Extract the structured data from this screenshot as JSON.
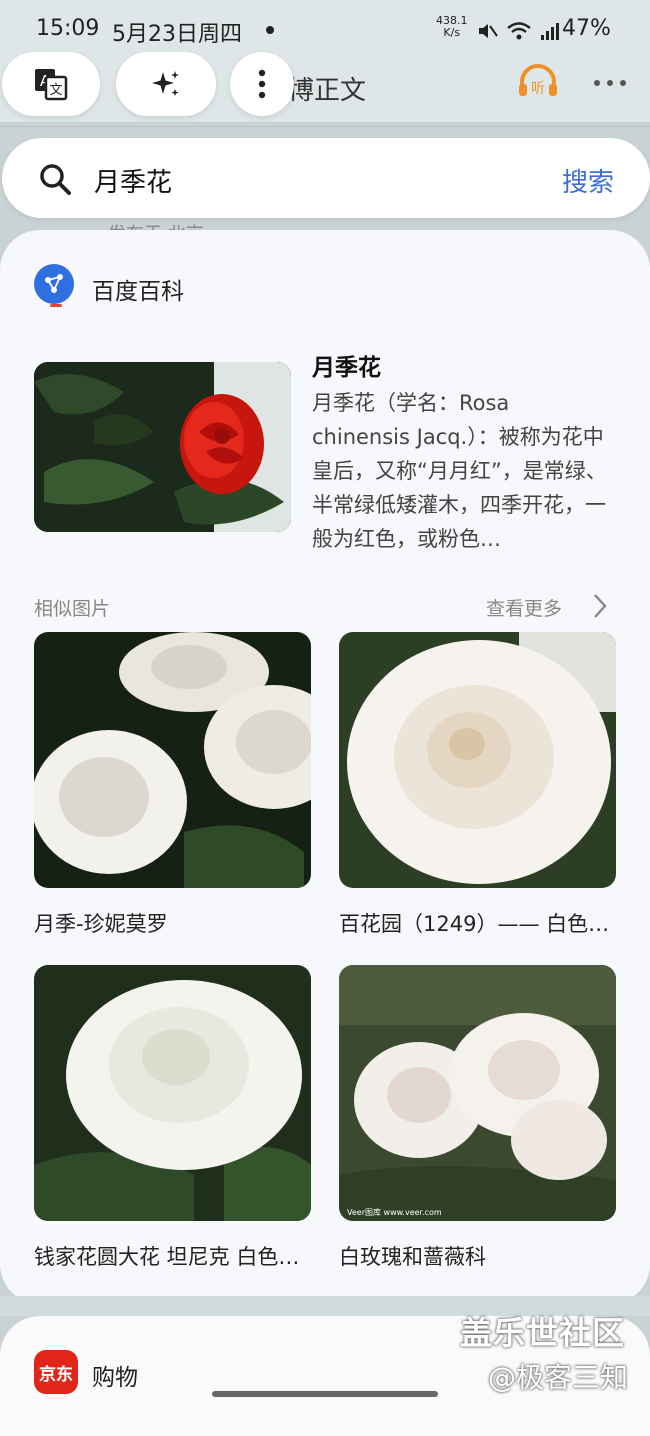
{
  "status_bar": {
    "time": "15:09",
    "date": "5月23日周四",
    "net_speed_value": "438.1",
    "net_speed_unit": "K/s",
    "battery": "47%"
  },
  "background_page": {
    "title_fragment": "博正文",
    "listen_label": "听",
    "peek_text": "发布于 北京"
  },
  "fab": {
    "translate_icon": "translate-icon",
    "sparkle_icon": "sparkle-icon",
    "more_icon": "more-vertical-icon"
  },
  "search": {
    "query": "月季花",
    "button_label": "搜索"
  },
  "baike": {
    "source": "百度百科",
    "title": "月季花",
    "description": "月季花（学名：Rosa chinensis Jacq.）：被称为花中皇后，又称“月月红”，是常绿、半常绿低矮灌木，四季开花，一般为红色，或粉色…"
  },
  "similar": {
    "label": "相似图片",
    "see_more": "查看更多",
    "items": [
      {
        "caption": "月季-珍妮莫罗"
      },
      {
        "caption": "百花园（1249）—— 白色…"
      },
      {
        "caption": "钱家花圆大花 坦尼克 白色…"
      },
      {
        "caption": "白玫瑰和蔷薇科"
      }
    ],
    "image_watermark": "Veer图库 www.veer.com"
  },
  "shopping": {
    "logo_text": "京东",
    "label": "购物"
  },
  "watermark": {
    "line1": "盖乐世社区",
    "line2": "@极客三知"
  },
  "colors": {
    "accent": "#3d6ed6",
    "jd_red": "#e1251b",
    "rose_red": "#d81f1a"
  }
}
